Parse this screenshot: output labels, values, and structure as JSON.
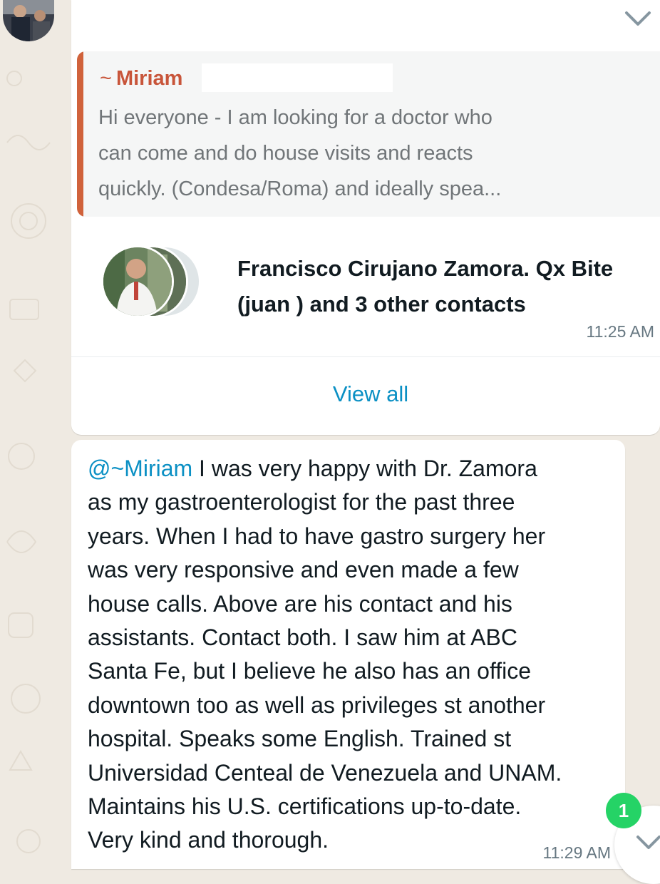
{
  "quote": {
    "tilde": "~",
    "author": "Miriam",
    "line1": "Hi everyone - I am looking for a doctor who",
    "line2": "can come and do house visits and reacts",
    "line3": "quickly. (Condesa/Roma) and ideally spea..."
  },
  "contact_card": {
    "names_line1": "Francisco Cirujano Zamora. Qx Bite",
    "names_line2": "(juan ) and 3 other contacts",
    "time": "11:25 AM",
    "view_all": "View all"
  },
  "message": {
    "mention": "@~Miriam",
    "lines": [
      " I was very happy with Dr. Zamora",
      "as my gastroenterologist for the past three",
      "years. When I had to have gastro surgery her",
      "was very responsive and even made a few",
      "house calls. Above are his contact and his",
      "assistants. Contact both. I saw him at ABC",
      "Santa Fe, but I believe he also has an office",
      "downtown too as well as privileges st another",
      "hospital. Speaks some English. Trained st",
      "Universidad Centeal de Venezuela and UNAM.",
      "Maintains his U.S. certifications up-to-date.",
      "Very kind and thorough."
    ],
    "time": "11:29 AM"
  },
  "unread_count": "1",
  "colors": {
    "background": "#efeae2",
    "quote_accent": "#d0623b",
    "link": "#0b90c4",
    "badge": "#25d366"
  },
  "icons": {
    "menu": "chevron-down-icon",
    "scroll": "chevron-down-icon"
  }
}
